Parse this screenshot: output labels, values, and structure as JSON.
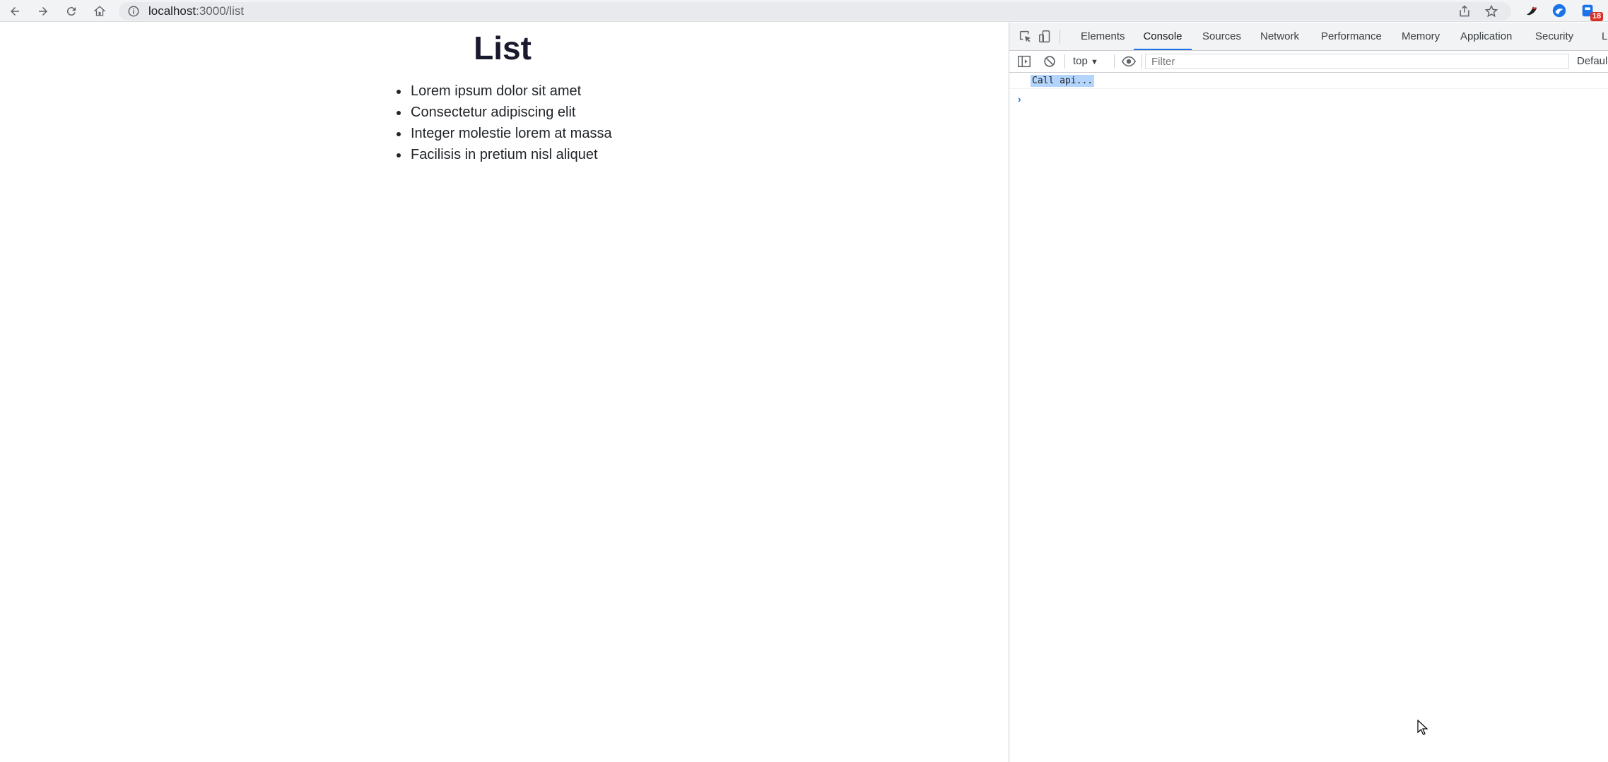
{
  "browser": {
    "url_host": "localhost",
    "url_path": ":3000/list",
    "extension_badge": "18"
  },
  "page": {
    "title": "List",
    "items": [
      "Lorem ipsum dolor sit amet",
      "Consectetur adipiscing elit",
      "Integer molestie lorem at massa",
      "Facilisis in pretium nisl aliquet"
    ]
  },
  "devtools": {
    "tabs": [
      "Elements",
      "Console",
      "Sources",
      "Network",
      "Performance",
      "Memory",
      "Application",
      "Security",
      "Li"
    ],
    "active_tab": "Console",
    "context": "top",
    "filter_placeholder": "Filter",
    "levels_label": "Defaul",
    "console_message": "Call api...",
    "accent_color": "#1a73e8"
  }
}
